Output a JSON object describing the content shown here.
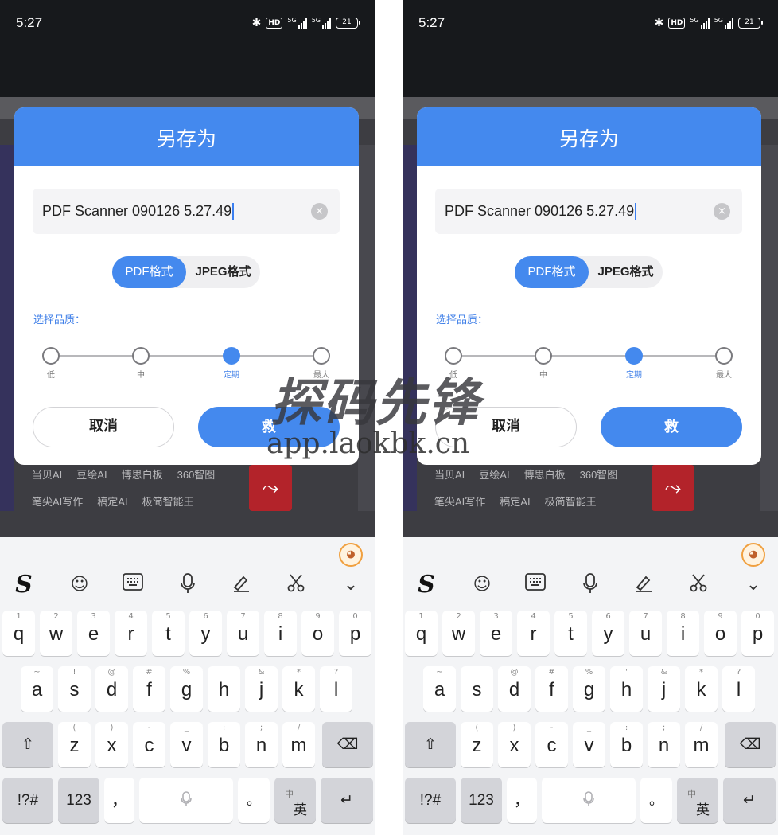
{
  "status_bar": {
    "time": "5:27",
    "hd": "HD",
    "network_1": "5G",
    "network_2": "5G",
    "battery": "21"
  },
  "background": {
    "row1": [
      "当贝AI",
      "豆绘AI",
      "博思白板",
      "360智图"
    ],
    "row2": [
      "笔尖AI写作",
      "稿定AI",
      "极简智能王"
    ],
    "pdf_glyph": "⤳"
  },
  "dialog": {
    "title": "另存为",
    "filename": "PDF Scanner 090126 5.27.49",
    "clear_icon": "×",
    "formats": [
      "PDF格式",
      "JPEG格式"
    ],
    "selected_format": "PDF格式",
    "quality_label": "选择品质：",
    "quality_levels": [
      "低",
      "中",
      "定期",
      "最大"
    ],
    "selected_quality": "定期",
    "cancel": "取消",
    "save": "救"
  },
  "keyboard": {
    "toolbar": [
      "sogou-logo-icon",
      "emoji-icon",
      "keyboard-icon",
      "microphone-icon",
      "handwriting-icon",
      "scissors-icon",
      "collapse-chevron-icon"
    ],
    "logo": "S",
    "emoji": "☺",
    "chevron": "⌄",
    "row1": [
      {
        "hint": "1",
        "ch": "q"
      },
      {
        "hint": "2",
        "ch": "w"
      },
      {
        "hint": "3",
        "ch": "e"
      },
      {
        "hint": "4",
        "ch": "r"
      },
      {
        "hint": "5",
        "ch": "t"
      },
      {
        "hint": "6",
        "ch": "y"
      },
      {
        "hint": "7",
        "ch": "u"
      },
      {
        "hint": "8",
        "ch": "i"
      },
      {
        "hint": "9",
        "ch": "o"
      },
      {
        "hint": "0",
        "ch": "p"
      }
    ],
    "row2": [
      {
        "hint": "~",
        "ch": "a"
      },
      {
        "hint": "!",
        "ch": "s"
      },
      {
        "hint": "@",
        "ch": "d"
      },
      {
        "hint": "#",
        "ch": "f"
      },
      {
        "hint": "%",
        "ch": "g"
      },
      {
        "hint": "'",
        "ch": "h"
      },
      {
        "hint": "&",
        "ch": "j"
      },
      {
        "hint": "*",
        "ch": "k"
      },
      {
        "hint": "?",
        "ch": "l"
      }
    ],
    "row3": [
      {
        "hint": "(",
        "ch": "z"
      },
      {
        "hint": ")",
        "ch": "x"
      },
      {
        "hint": "-",
        "ch": "c"
      },
      {
        "hint": "_",
        "ch": "v"
      },
      {
        "hint": ":",
        "ch": "b"
      },
      {
        "hint": ";",
        "ch": "n"
      },
      {
        "hint": "/",
        "ch": "m"
      }
    ],
    "shift": "⇧",
    "backspace": "⌫",
    "symbols": "!?#",
    "numbers": "123",
    "comma": "，",
    "period": "。",
    "lang_small": "中",
    "lang_big": "英",
    "enter": "↵"
  },
  "watermark": {
    "text": "探码先锋",
    "url": "app.laokbk.cn"
  }
}
